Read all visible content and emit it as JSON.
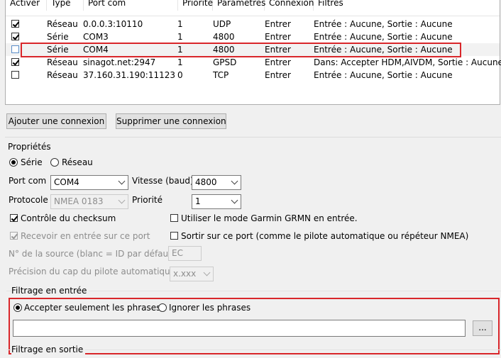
{
  "list": {
    "columns": [
      "Activer",
      "Type",
      "Port com",
      "Priorité",
      "Paramètres",
      "Connexion",
      "Filtres"
    ],
    "rows": [
      {
        "enabled": true,
        "type": "Réseau",
        "port": "0.0.0.3:10110",
        "priority": "1",
        "params": "UDP",
        "connection": "Entrer",
        "filters": "Entrée : Aucune, Sortie : Aucune"
      },
      {
        "enabled": true,
        "type": "Série",
        "port": "COM3",
        "priority": "1",
        "params": "4800",
        "connection": "Entrer",
        "filters": "Entrée : Aucune, Sortie : Aucune"
      },
      {
        "enabled": false,
        "type": "Série",
        "port": "COM4",
        "priority": "1",
        "params": "4800",
        "connection": "Entrer",
        "filters": "Entrée : Aucune, Sortie : Aucune"
      },
      {
        "enabled": true,
        "type": "Réseau",
        "port": "sinagot.net:2947",
        "priority": "1",
        "params": "GPSD",
        "connection": "Entrer",
        "filters": "Dans: Accepter HDM,AIVDM, Sortie : Aucune"
      },
      {
        "enabled": false,
        "type": "Réseau",
        "port": "37.160.31.190:11123",
        "priority": "0",
        "params": "TCP",
        "connection": "Entrer",
        "filters": "Entrée : Aucune, Sortie : Aucune"
      }
    ]
  },
  "buttons": {
    "add": "Ajouter une connexion",
    "remove": "Supprimer une connexion",
    "browse": "..."
  },
  "properties": {
    "title": "Propriétés",
    "radio_serie": "Série",
    "radio_reseau": "Réseau",
    "port_label": "Port com",
    "port_value": "COM4",
    "speed_label": "Vitesse (baud)",
    "speed_value": "4800",
    "protocol_label": "Protocole",
    "protocol_value": "NMEA 0183",
    "priority_label": "Priorité",
    "priority_value": "1",
    "checksum_label": "Contrôle du checksum",
    "garmin_label": "Utiliser le mode Garmin GRMN en entrée.",
    "receive_label": "Recevoir en entrée sur ce port",
    "output_label": "Sortir sur ce port (comme le pilote automatique ou répéteur NMEA)",
    "source_label": "N° de la source (blanc = ID par défaut)",
    "source_value": "EC",
    "precision_label": "Précision du cap du pilote automatique",
    "precision_value": "x.xxx"
  },
  "input_filter": {
    "title": "Filtrage en entrée",
    "accept_label": "Accepter seulement les phrases",
    "ignore_label": "Ignorer les phrases",
    "sentences_value": ""
  },
  "output_filter": {
    "title": "Filtrage en sortie"
  },
  "colors": {
    "highlight": "#d9262a"
  }
}
